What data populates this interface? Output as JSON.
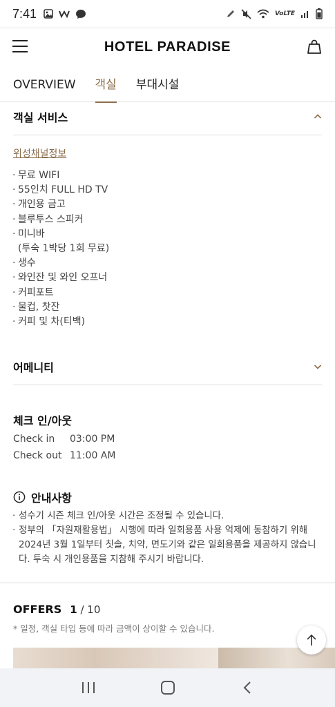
{
  "status": {
    "time": "7:41",
    "left_icons": [
      "image-icon",
      "w-app-icon",
      "chat-icon"
    ],
    "right_icons": [
      "pen-icon",
      "mute-icon",
      "wifi-icon",
      "volte-icon",
      "signal-icon",
      "battery-icon"
    ],
    "volte_label": "VoLTE"
  },
  "header": {
    "brand": "HOTEL PARADISE"
  },
  "tabs": [
    {
      "label": "OVERVIEW",
      "active": false
    },
    {
      "label": "객실",
      "active": true
    },
    {
      "label": "부대시설",
      "active": false
    }
  ],
  "room_services": {
    "title": "객실 서비스",
    "expanded": true,
    "link": "위성채널정보",
    "items": [
      "무료 WIFI",
      "55인치 FULL HD TV",
      "개인용 금고",
      "블루투스 스피커",
      "미니바",
      "(투숙 1박당 1회 무료)",
      "생수",
      "와인잔 및 와인 오프너",
      "커피포트",
      "물컵, 찻잔",
      "커피 및 차(티백)"
    ]
  },
  "amenity": {
    "title": "어메니티",
    "expanded": false
  },
  "check": {
    "title": "체크 인/아웃",
    "in_label": "Check in",
    "in_time": "03:00 PM",
    "out_label": "Check out",
    "out_time": "11:00 AM"
  },
  "notice": {
    "title": "안내사항",
    "items": [
      "성수기 시즌 체크 인/아웃 시간은 조정될 수 있습니다.",
      "정부의 「자원재활용법」 시행에 따라 일회용품 사용 억제에 동참하기 위해 2024년 3월 1일부터 칫솔, 치약, 면도기와 같은 일회용품을 제공하지 않습니다. 투숙 시 개인용품을 지참해 주시기 바랍니다."
    ]
  },
  "offers": {
    "title": "OFFERS",
    "current": "1",
    "total": "/ 10",
    "note": "* 일정, 객실 타입 등에 따라 금액이 상이할 수 있습니다."
  },
  "colors": {
    "accent": "#8a6d4b",
    "nav_bg": "#f1f3f7"
  }
}
